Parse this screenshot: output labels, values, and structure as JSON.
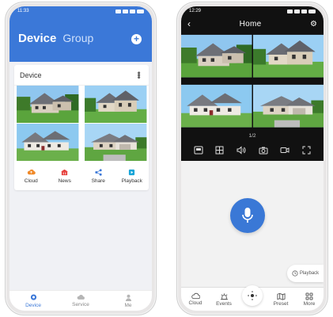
{
  "left_phone": {
    "status_time": "11:33",
    "header": {
      "title_active": "Device",
      "title_inactive": "Group",
      "add_icon": "plus-circle-icon"
    },
    "device_card": {
      "title": "Device",
      "actions": [
        {
          "label": "Cloud",
          "icon": "cloud-upload-icon",
          "color": "#f08a2a"
        },
        {
          "label": "News",
          "icon": "news-icon",
          "color": "#e53935"
        },
        {
          "label": "Share",
          "icon": "share-icon",
          "color": "#3b78d8"
        },
        {
          "label": "Playback",
          "icon": "playback-icon",
          "color": "#19a5d8"
        }
      ]
    },
    "tabs": [
      {
        "label": "Device",
        "icon": "camera-icon",
        "active": true
      },
      {
        "label": "Service",
        "icon": "cloud-icon",
        "active": false
      },
      {
        "label": "Me",
        "icon": "person-icon",
        "active": false
      }
    ],
    "accent": "#3b78d8"
  },
  "right_phone": {
    "status_time": "12:29",
    "nav": {
      "title": "Home",
      "back_icon": "back-arrow-icon",
      "settings_icon": "gear-icon"
    },
    "page_indicator": "1/2",
    "toolbar_icons": [
      "sd-card-icon",
      "grid-icon",
      "speaker-icon",
      "camera-snapshot-icon",
      "record-icon",
      "fullscreen-icon"
    ],
    "mic_icon": "microphone-icon",
    "playback_label": "Playback",
    "tabs": [
      {
        "label": "Cloud",
        "icon": "cloud-icon"
      },
      {
        "label": "Events",
        "icon": "alarm-icon"
      },
      {
        "label": "",
        "icon": "ptz-control-icon"
      },
      {
        "label": "Preset",
        "icon": "map-icon"
      },
      {
        "label": "More",
        "icon": "apps-icon"
      }
    ]
  }
}
